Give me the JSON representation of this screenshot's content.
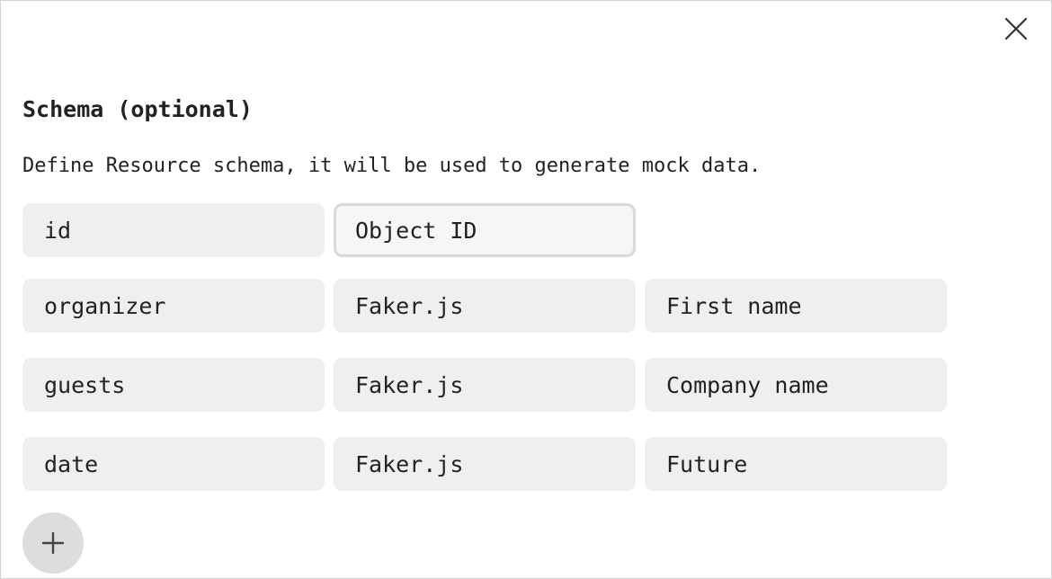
{
  "dialog": {
    "title": "Schema (optional)",
    "description": "Define Resource schema, it will be used to generate mock data.",
    "close_icon": "close-icon",
    "add_icon": "plus-icon"
  },
  "schema": {
    "rows": [
      {
        "field": "id",
        "generator": "Object ID",
        "type": ""
      },
      {
        "field": "organizer",
        "generator": "Faker.js",
        "type": "First name"
      },
      {
        "field": "guests",
        "generator": "Faker.js",
        "type": "Company name"
      },
      {
        "field": "date",
        "generator": "Faker.js",
        "type": "Future"
      }
    ]
  },
  "colors": {
    "cell_background": "#efefef",
    "active_cell_border": "#d9d9d9",
    "add_button_background": "#dddddd",
    "text": "#222222"
  }
}
